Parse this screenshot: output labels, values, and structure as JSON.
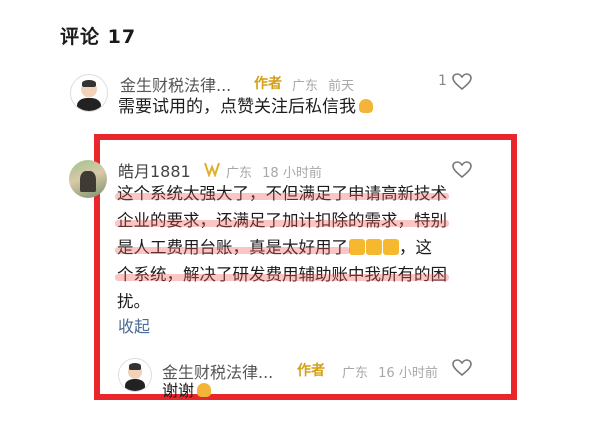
{
  "header": {
    "title": "评论 17"
  },
  "comment1": {
    "username": "金生财税法律...",
    "author_tag": "作者",
    "location": "广东",
    "time": "前天",
    "like_count": "1",
    "text": "需要试用的，点赞关注后私信我"
  },
  "comment2": {
    "username": "皓月1881",
    "location": "广东",
    "time": "18 小时前",
    "lines": [
      "这个系统太强大了，不但满足了申请高新技术",
      "企业的要求，还满足了加计扣除的需求，特别",
      "是人工费用台账，真是太好用了",
      "，这",
      "个系统，解决了研发费用辅助账中我所有的困",
      "扰。"
    ],
    "collapse_label": "收起"
  },
  "reply": {
    "username": "金生财税法律...",
    "author_tag": "作者",
    "location": "广东",
    "time": "16 小时前",
    "text": "谢谢"
  },
  "colors": {
    "frame": "#e8262b",
    "author_tag": "#d4a017",
    "link": "#4a6b95"
  }
}
